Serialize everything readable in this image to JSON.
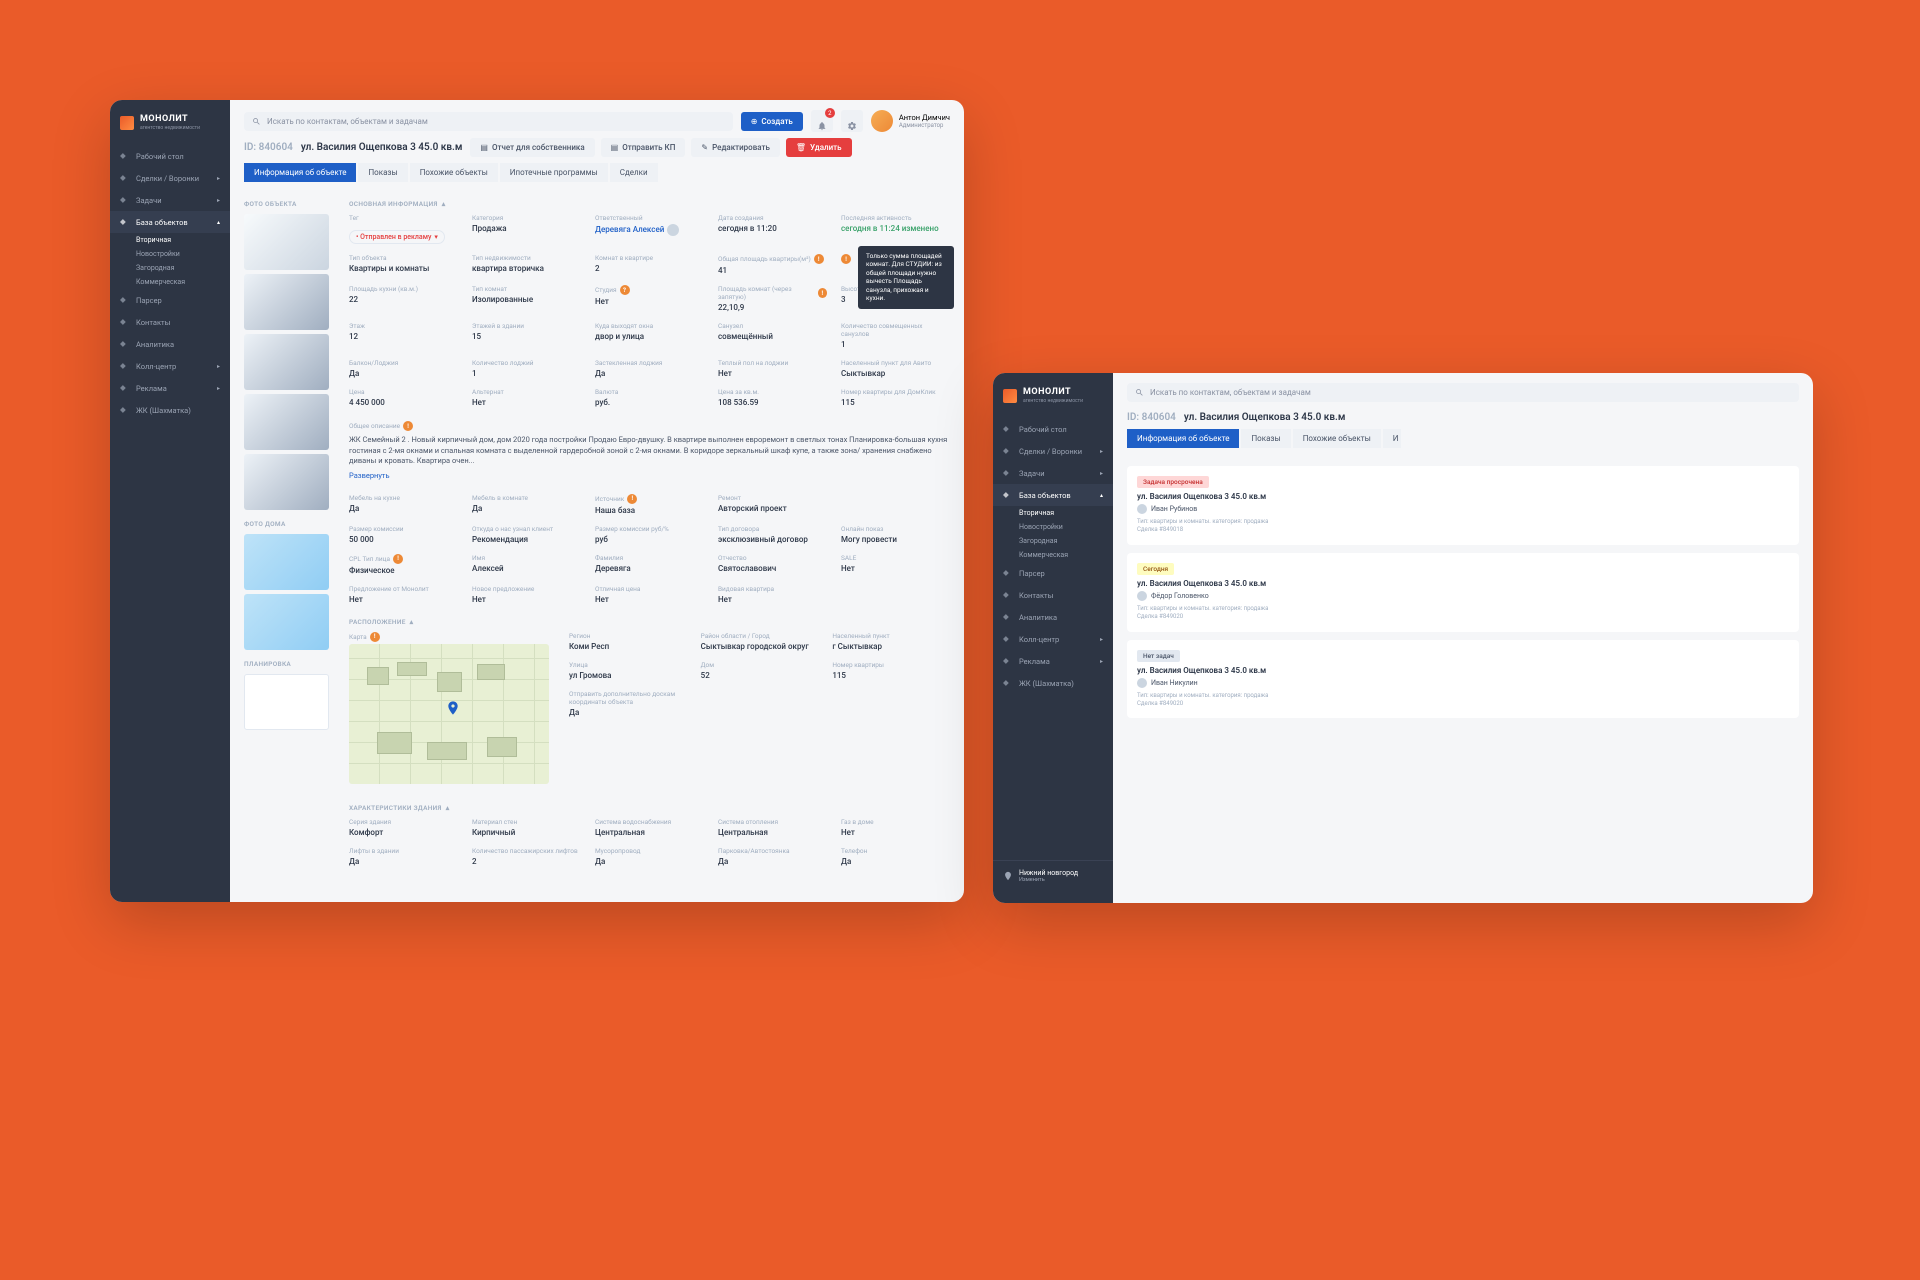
{
  "brand": {
    "name": "МОНОЛИТ",
    "sub": "агентство недвижимости"
  },
  "search_placeholder": "Искать по контактам, объектам и задачам",
  "topbar": {
    "create": "Создать",
    "notif_count": "2",
    "user_name": "Антон Димчич",
    "user_role": "Администратор"
  },
  "sidebar": {
    "items": [
      {
        "label": "Рабочий стол",
        "icon": "home"
      },
      {
        "label": "Сделки / Воронки",
        "icon": "deal",
        "chev": true
      },
      {
        "label": "Задачи",
        "icon": "task",
        "chev": true
      },
      {
        "label": "База объектов",
        "icon": "db",
        "chev": true,
        "active": true
      },
      {
        "label": "Парсер",
        "icon": "parser"
      },
      {
        "label": "Контакты",
        "icon": "contacts"
      },
      {
        "label": "Аналитика",
        "icon": "analytics"
      },
      {
        "label": "Колл-центр",
        "icon": "call",
        "chev": true
      },
      {
        "label": "Реклама",
        "icon": "ads",
        "chev": true
      },
      {
        "label": "ЖК (Шахматка)",
        "icon": "building"
      }
    ],
    "subs": [
      "Вторичная",
      "Новостройки",
      "Загородная",
      "Коммерческая"
    ],
    "footer": {
      "city": "Нижний новгород",
      "change": "Изменить"
    }
  },
  "page": {
    "id": "ID: 840604",
    "title": "ул. Василия Ощепкова 3 45.0 кв.м",
    "actions": {
      "report": "Отчет для собственника",
      "send": "Отправить КП",
      "edit": "Редактировать",
      "delete": "Удалить"
    },
    "tabs": [
      "Информация об объекте",
      "Показы",
      "Похожие объекты",
      "Ипотечные программы",
      "Сделки"
    ]
  },
  "sections": {
    "photo_obj": "ФОТО ОБЪЕКТА",
    "photo_house": "ФОТО ДОМА",
    "plan": "ПЛАНИРОВКА",
    "main_info": "ОСНОВНАЯ ИНФОРМАЦИЯ",
    "location": "РАСПОЛОЖЕНИЕ",
    "building": "ХАРАКТЕРИСТИКИ ЗДАНИЯ"
  },
  "fields1": [
    {
      "l": "Тег",
      "v": "Отправлен в рекламу",
      "tag": true
    },
    {
      "l": "Категория",
      "v": "Продажа"
    },
    {
      "l": "Ответственный",
      "v": "Деревяга Алексей",
      "link": true,
      "ava": true
    },
    {
      "l": "Дата создания",
      "v": "сегодня в 11:20"
    },
    {
      "l": "Последняя активность",
      "v": "сегодня в 11:24 изменено",
      "green": true
    },
    {
      "l": "Тип объекта",
      "v": "Квартиры и комнаты"
    },
    {
      "l": "Тип недвижимости",
      "v": "квартира вторичка"
    },
    {
      "l": "Комнат в квартире",
      "v": "2"
    },
    {
      "l": "Общая площадь квартиры(м²)",
      "v": "41",
      "dot": "!"
    },
    {
      "l": "",
      "v": "",
      "dot": "!"
    },
    {
      "l": "Площадь кухни (кв.м.)",
      "v": "22"
    },
    {
      "l": "Тип комнат",
      "v": "Изолированные"
    },
    {
      "l": "Студия",
      "v": "Нет",
      "dot": "?"
    },
    {
      "l": "Площадь комнат (через запятую)",
      "v": "22,10,9",
      "dot": "!"
    },
    {
      "l": "Высота потолков (м.)",
      "v": "3"
    },
    {
      "l": "Этаж",
      "v": "12"
    },
    {
      "l": "Этажей в здании",
      "v": "15"
    },
    {
      "l": "Куда выходят окна",
      "v": "двор и улица"
    },
    {
      "l": "Санузел",
      "v": "совмещённый"
    },
    {
      "l": "Количество совмещенных санузлов",
      "v": "1"
    },
    {
      "l": "Балкон/Лоджия",
      "v": "Да"
    },
    {
      "l": "Количество лоджий",
      "v": "1"
    },
    {
      "l": "Застекленная лоджия",
      "v": "Да"
    },
    {
      "l": "Теплый пол на лоджии",
      "v": "Нет"
    },
    {
      "l": "Населенный пункт для Авито",
      "v": "Сыктывкар"
    },
    {
      "l": "Цена",
      "v": "4 450 000"
    },
    {
      "l": "Альтернат",
      "v": "Нет"
    },
    {
      "l": "Валюта",
      "v": "руб."
    },
    {
      "l": "Цена за кв.м.",
      "v": "108 536.59"
    },
    {
      "l": "Номер квартиры для ДомКлик",
      "v": "115"
    }
  ],
  "desc_label": "Общее описание",
  "desc": "ЖК Семейный 2 . Новый кирпичный дом, дом 2020 года постройки Продаю Евро-двушку. В квартире выполнен евроремонт в светлых тонах Планировка-большая кухня гостиная с 2-мя окнами и спальная комната с выделенной гардеробной зоной с 2-мя окнами. В коридоре зеркальный шкаф купе, а также зона/ хранения снабжено диваны и кровать. Квартира очен...",
  "expand": "Развернуть",
  "fields2": [
    {
      "l": "Мебель на кухне",
      "v": "Да"
    },
    {
      "l": "Мебель в комнате",
      "v": "Да"
    },
    {
      "l": "Источник",
      "v": "Наша база",
      "dot": "!"
    },
    {
      "l": "Ремонт",
      "v": "Авторский проект"
    },
    {
      "l": "",
      "v": ""
    },
    {
      "l": "Размер комиссии",
      "v": "50 000"
    },
    {
      "l": "Откуда о нас узнал клиент",
      "v": "Рекомендация"
    },
    {
      "l": "Размер комиссии руб/%",
      "v": "руб"
    },
    {
      "l": "Тип договора",
      "v": "эксклюзивный договор"
    },
    {
      "l": "Онлайн показ",
      "v": "Могу провести"
    },
    {
      "l": "CPL Тип лица",
      "v": "Физическое",
      "dot": "!"
    },
    {
      "l": "Имя",
      "v": "Алексей"
    },
    {
      "l": "Фамилия",
      "v": "Деревяга"
    },
    {
      "l": "Отчество",
      "v": "Святославович"
    },
    {
      "l": "SALE",
      "v": "Нет"
    },
    {
      "l": "Предложение от Монолит",
      "v": "Нет"
    },
    {
      "l": "Новое предложение",
      "v": "Нет"
    },
    {
      "l": "Отличная цена",
      "v": "Нет"
    },
    {
      "l": "Видовая квартира",
      "v": "Нет"
    },
    {
      "l": "",
      "v": ""
    }
  ],
  "tooltip": "Только сумма площадей комнат. Для СТУДИИ: из общей площади нужно вычесть Площадь санузла, прихожая и кухни.",
  "map_label": "Карта",
  "location_fields": [
    {
      "l": "Регион",
      "v": "Коми Респ"
    },
    {
      "l": "Район области / Город",
      "v": "Сыктывкар городской округ"
    },
    {
      "l": "Населенный пункт",
      "v": "г Сыктывкар"
    },
    {
      "l": "Улица",
      "v": "ул Громова"
    },
    {
      "l": "Дом",
      "v": "52"
    },
    {
      "l": "Номер квартиры",
      "v": "115"
    },
    {
      "l": "Отправить дополнительно доскам координаты объекта",
      "v": "Да"
    }
  ],
  "building_fields": [
    {
      "l": "Серия здания",
      "v": "Комфорт"
    },
    {
      "l": "Материал стен",
      "v": "Кирпичный"
    },
    {
      "l": "Система водоснабжения",
      "v": "Центральная"
    },
    {
      "l": "Система отопления",
      "v": "Центральная"
    },
    {
      "l": "Газ в доме",
      "v": "Нет"
    },
    {
      "l": "Лифты в здании",
      "v": "Да"
    },
    {
      "l": "Количество пассажирских лифтов",
      "v": "2"
    },
    {
      "l": "Мусоропровод",
      "v": "Да"
    },
    {
      "l": "Парковка/Автостоянка",
      "v": "Да"
    },
    {
      "l": "Телефон",
      "v": "Да"
    }
  ],
  "tasks": [
    {
      "tag": "Задача просрочена",
      "tagClass": "red",
      "title": "ул. Василия Ощепкова 3 45.0 кв.м",
      "user": "Иван Рубинов",
      "meta1": "Тип: квартиры и комнаты. категория: продажа",
      "meta2": "Сделка #849018"
    },
    {
      "tag": "Сегодня",
      "tagClass": "yellow",
      "title": "ул. Василия Ощепкова 3 45.0 кв.м",
      "user": "Фёдор Головенко",
      "meta1": "Тип: квартиры и комнаты. категория: продажа",
      "meta2": "Сделка #849020"
    },
    {
      "tag": "Нет задач",
      "tagClass": "gray",
      "title": "ул. Василия Ощепкова 3 45.0 кв.м",
      "user": "Иван Никулин",
      "meta1": "Тип: квартиры и комнаты. категория: продажа",
      "meta2": "Сделка #849020"
    }
  ]
}
